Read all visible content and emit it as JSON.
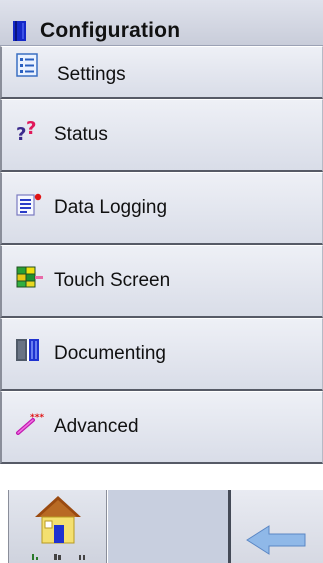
{
  "header": {
    "title": "Configuration",
    "icon": "book-icon"
  },
  "menu": {
    "items": [
      {
        "label": "Settings",
        "icon": "settings-list-icon"
      },
      {
        "label": "Status",
        "icon": "question-marks-icon"
      },
      {
        "label": "Data Logging",
        "icon": "data-logging-icon"
      },
      {
        "label": "Touch Screen",
        "icon": "touch-grid-icon"
      },
      {
        "label": "Documenting",
        "icon": "documenting-icon"
      },
      {
        "label": "Advanced",
        "icon": "magic-wand-icon"
      }
    ]
  },
  "footer": {
    "home_icon": "home-icon",
    "back_icon": "back-arrow-icon"
  },
  "colors": {
    "header_bg": "#d5d9e5",
    "item_bg": "#e4e7ef",
    "accent_blue": "#1428c8",
    "divider": "#444a57"
  }
}
